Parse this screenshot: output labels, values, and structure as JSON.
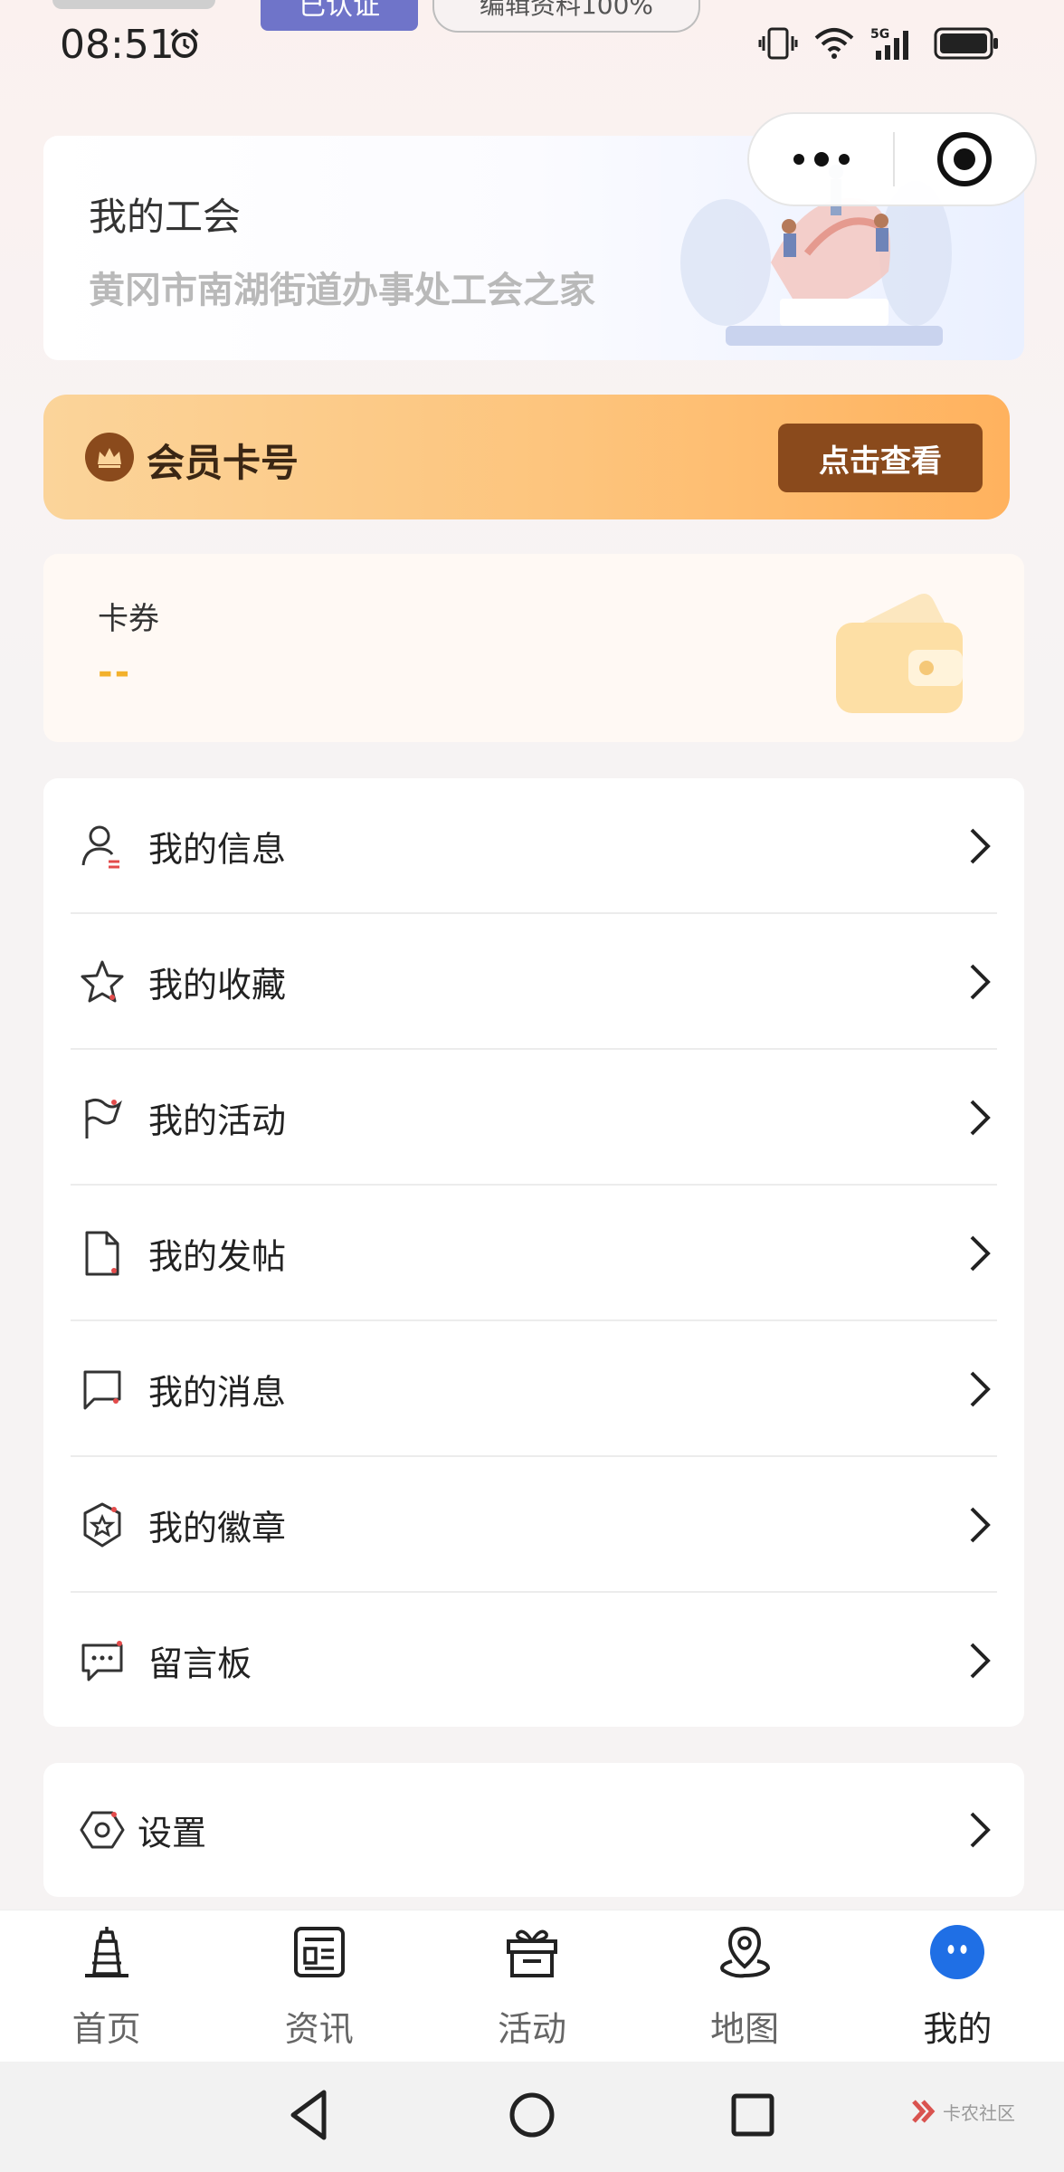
{
  "status_bar": {
    "time": "08:51"
  },
  "profile_header": {
    "certified_label": "已认证",
    "edit_profile_label": "编辑资料100%"
  },
  "union": {
    "title": "我的工会",
    "name": "黄冈市南湖街道办事处工会之家"
  },
  "member": {
    "label": "会员卡号",
    "button": "点击查看"
  },
  "coupon": {
    "label": "卡券",
    "value": "--"
  },
  "menu": {
    "items": [
      {
        "label": "我的信息",
        "icon": "user-icon"
      },
      {
        "label": "我的收藏",
        "icon": "star-icon"
      },
      {
        "label": "我的活动",
        "icon": "flag-icon"
      },
      {
        "label": "我的发帖",
        "icon": "document-icon"
      },
      {
        "label": "我的消息",
        "icon": "message-icon"
      },
      {
        "label": "我的徽章",
        "icon": "badge-icon"
      },
      {
        "label": "留言板",
        "icon": "comment-board-icon"
      }
    ]
  },
  "settings": {
    "label": "设置",
    "icon": "settings-icon"
  },
  "tabbar": {
    "tabs": [
      {
        "label": "首页",
        "icon": "home-icon"
      },
      {
        "label": "资讯",
        "icon": "news-icon"
      },
      {
        "label": "活动",
        "icon": "gift-icon"
      },
      {
        "label": "地图",
        "icon": "map-pin-icon"
      },
      {
        "label": "我的",
        "icon": "profile-face-icon",
        "active": true
      }
    ]
  },
  "watermark": {
    "text": "卡农社区"
  },
  "colors": {
    "accent_brown": "#8a4a1c",
    "member_gradient_start": "#fbd49a",
    "member_gradient_end": "#ffb25e",
    "coupon_yellow": "#f3b12b",
    "active_tab_blue": "#1f6fe5",
    "certified_purple": "#6f74c9"
  }
}
